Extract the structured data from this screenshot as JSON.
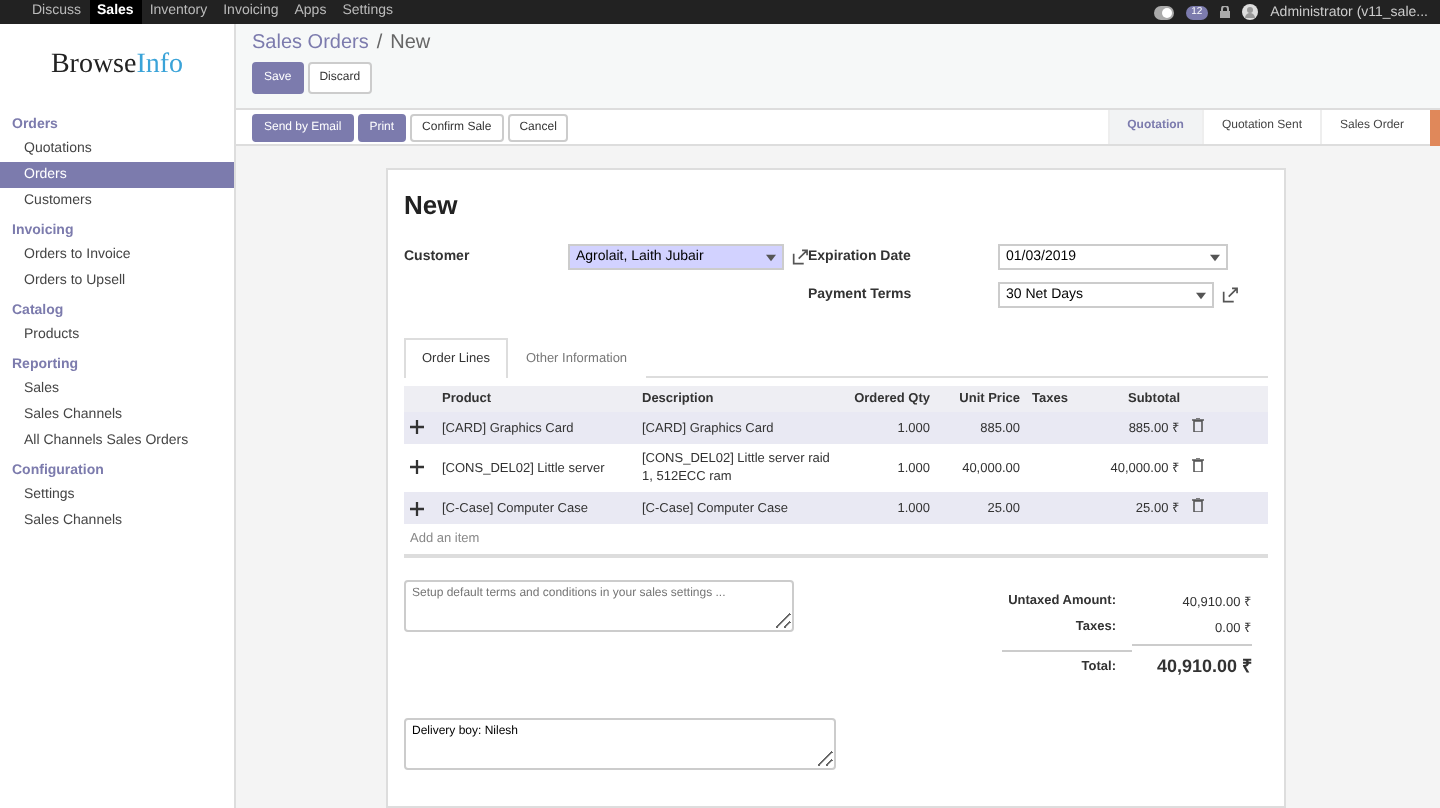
{
  "top_menu": [
    {
      "label": "Discuss",
      "selected": false
    },
    {
      "label": "Sales",
      "selected": true
    },
    {
      "label": "Inventory",
      "selected": false
    },
    {
      "label": "Invoicing",
      "selected": false
    },
    {
      "label": "Apps",
      "selected": false
    },
    {
      "label": "Settings",
      "selected": false
    }
  ],
  "chat_badge": "12",
  "user": "Administrator (v11_sale...",
  "logo": {
    "dark": "Browse",
    "light": "Info"
  },
  "sidebar": [
    {
      "title": "Orders",
      "items": [
        {
          "label": "Quotations",
          "selected": false
        },
        {
          "label": "Orders",
          "selected": true
        },
        {
          "label": "Customers",
          "selected": false
        }
      ]
    },
    {
      "title": "Invoicing",
      "items": [
        {
          "label": "Orders to Invoice",
          "selected": false
        },
        {
          "label": "Orders to Upsell",
          "selected": false
        }
      ]
    },
    {
      "title": "Catalog",
      "items": [
        {
          "label": "Products",
          "selected": false
        }
      ]
    },
    {
      "title": "Reporting",
      "items": [
        {
          "label": "Sales",
          "selected": false
        },
        {
          "label": "Sales Channels",
          "selected": false
        },
        {
          "label": "All Channels Sales Orders",
          "selected": false
        }
      ]
    },
    {
      "title": "Configuration",
      "items": [
        {
          "label": "Settings",
          "selected": false
        },
        {
          "label": "Sales Channels",
          "selected": false
        }
      ]
    }
  ],
  "breadcrumb": {
    "parent": "Sales Orders",
    "separator": "/",
    "current": "New"
  },
  "main_buttons": [
    {
      "label": "Save",
      "kind": "primary"
    },
    {
      "label": "Discard",
      "kind": "secondary"
    }
  ],
  "action_buttons": [
    {
      "label": "Send by Email",
      "kind": "primary"
    },
    {
      "label": "Print",
      "kind": "primary"
    },
    {
      "label": "Confirm Sale",
      "kind": "secondary"
    },
    {
      "label": "Cancel",
      "kind": "secondary"
    }
  ],
  "stages": [
    {
      "label": "Quotation",
      "selected": true
    },
    {
      "label": "Quotation Sent",
      "selected": false
    },
    {
      "label": "Sales Order",
      "selected": false
    }
  ],
  "form": {
    "title": "New",
    "customer": {
      "label": "Customer",
      "value": "Agrolait, Laith Jubair"
    },
    "expiration_date": {
      "label": "Expiration Date",
      "value": "01/03/2019"
    },
    "payment_terms": {
      "label": "Payment Terms",
      "value": "30 Net Days"
    }
  },
  "tabs": [
    {
      "label": "Order Lines",
      "selected": true
    },
    {
      "label": "Other Information",
      "selected": false
    }
  ],
  "table": {
    "columns": [
      "Product",
      "Description",
      "Ordered Qty",
      "Unit Price",
      "Taxes",
      "Subtotal"
    ],
    "rows": [
      [
        "[CARD] Graphics Card",
        "[CARD] Graphics Card",
        "1.000",
        "885.00",
        "",
        "885.00 ₹"
      ],
      [
        "[CONS_DEL02] Little server",
        "[CONS_DEL02] Little server raid 1, 512ECC ram",
        "1.000",
        "40,000.00",
        "",
        "40,000.00 ₹"
      ],
      [
        "[C-Case] Computer Case",
        "[C-Case] Computer Case",
        "1.000",
        "25.00",
        "",
        "25.00 ₹"
      ]
    ],
    "add_item": "Add an item"
  },
  "terms": {
    "placeholder": "Setup default terms and conditions in your sales settings ..."
  },
  "totals": [
    {
      "label": "Untaxed Amount:",
      "value": "40,910.00 ₹",
      "kind": "normal"
    },
    {
      "label": "Taxes:",
      "value": "0.00 ₹",
      "kind": "normal"
    },
    {
      "label": "Total:",
      "value": "40,910.00 ₹",
      "kind": "grand"
    }
  ],
  "note": {
    "value": "Delivery boy: Nilesh"
  }
}
